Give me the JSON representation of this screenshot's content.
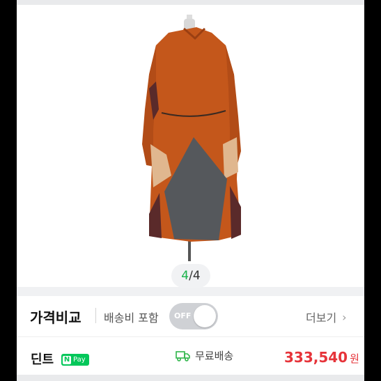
{
  "gallery": {
    "image_alt": "Coat on mannequin (back view)",
    "current_index": "4",
    "separator": "/",
    "total": "4"
  },
  "compare": {
    "title": "가격비교",
    "shipping_included_label": "배송비 포함",
    "toggle_state_label": "OFF",
    "more_label": "더보기"
  },
  "offer": {
    "seller_name": "딘트",
    "npay_badge": "Pay",
    "shipping_label": "무료배송",
    "price": "333,540",
    "currency": "원"
  },
  "colors": {
    "price": "#e6343a",
    "npay": "#03c75a",
    "counter_current": "#19b34a",
    "shipping_icon": "#2fb54a"
  }
}
